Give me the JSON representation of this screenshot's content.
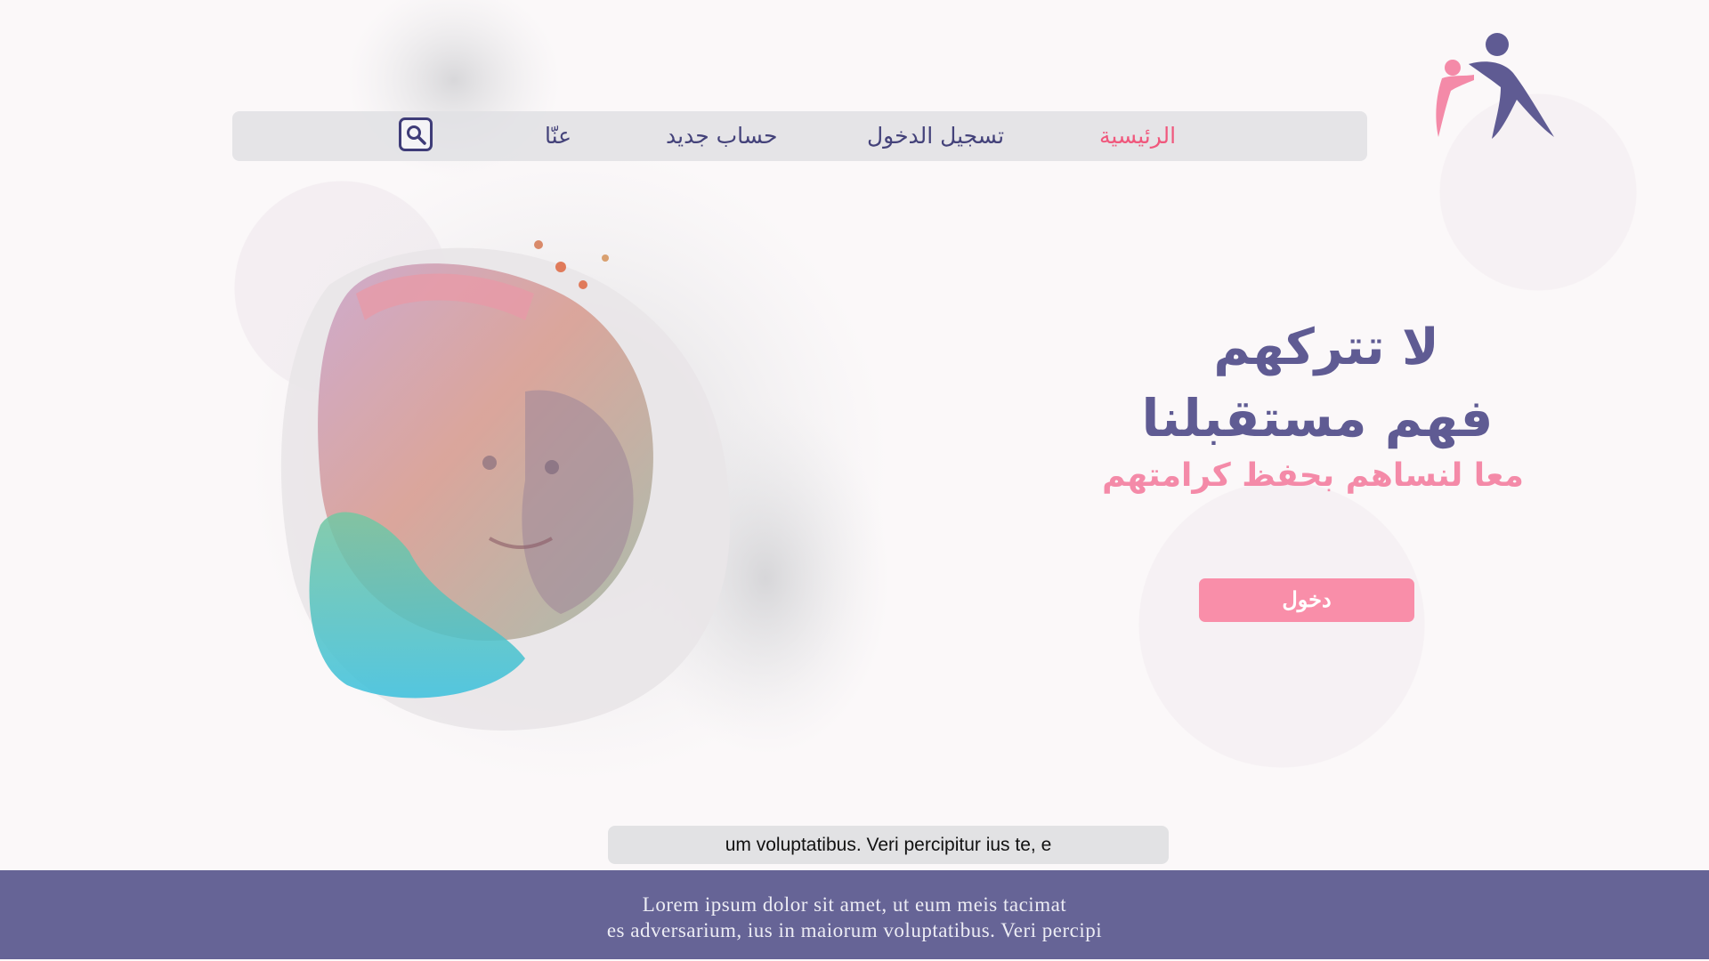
{
  "nav": {
    "home": "الرئيسية",
    "login": "تسجيل الدخول",
    "register": "حساب جديد",
    "about": "عنّا"
  },
  "hero": {
    "headline_line1": "لا تتركهم",
    "headline_line2": "فهم مستقبلنا",
    "subheadline": "معا لنساهم بحفظ كرامتهم",
    "enter_button": "دخول"
  },
  "caption_strip": "um voluptatibus. Veri percipitur ius te, e",
  "footer": {
    "line1": "Lorem ipsum dolor sit amet, ut eum meis tacimat",
    "line2": "es adversarium, ius in maiorum voluptatibus. Veri percipi"
  },
  "colors": {
    "accent_pink": "#f0587d",
    "brand_purple": "#5f5b93",
    "button_pink": "#f98ea9",
    "footer_bg": "#666496"
  },
  "icons": {
    "logo": "family-figures-logo",
    "search": "search-icon"
  }
}
